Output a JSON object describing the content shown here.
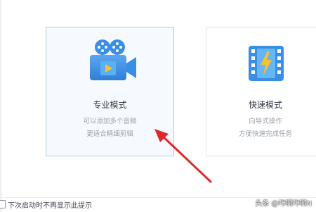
{
  "colors": {
    "accent_blue": "#3a8ee6",
    "selected_border": "#a9cdf0",
    "annotation_arrow": "#e02828"
  },
  "modes": [
    {
      "icon": "video-camera-icon",
      "title": "专业模式",
      "desc_line1": "可以添加多个音频",
      "desc_line2": "更适合精细剪辑",
      "selected": true
    },
    {
      "icon": "film-lightning-icon",
      "title": "快速模式",
      "desc_line1": "向导式操作",
      "desc_line2": "方便快速完成任务",
      "selected": false
    }
  ],
  "footer": {
    "checkbox_label": "下次启动时不再显示此提示",
    "checked": false
  },
  "watermark": {
    "text": "头条 @咋啊咋啊N"
  }
}
